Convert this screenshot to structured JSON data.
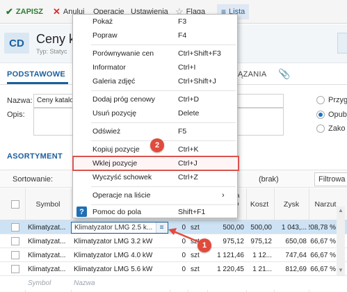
{
  "toolbar": {
    "save": "ZAPISZ",
    "cancel": "Anuluj",
    "operations": "Operacje",
    "settings": "Ustawienia",
    "flag": "Flaga",
    "list": "Lista"
  },
  "header": {
    "badge": "CD",
    "title": "Ceny k",
    "subtitle": "Typ: Statyc"
  },
  "tabs": {
    "main": "PODSTAWOWE",
    "other": "ĄZANIA"
  },
  "form": {
    "name_label": "Nazwa:",
    "name_value": "Ceny katalo",
    "desc_label": "Opis:",
    "radios": [
      {
        "label": "Przyg",
        "checked": false
      },
      {
        "label": "Opub",
        "checked": true
      },
      {
        "label": "Zako",
        "checked": false
      }
    ]
  },
  "section": {
    "title": "ASORTYMENT",
    "sort_label": "Sortowanie:",
    "sort_value": "(brak)",
    "filter_label": "Filtrowa"
  },
  "grid": {
    "columns": {
      "symbol": "Symbol",
      "cena": "Cena\nnetto\nakcji",
      "koszt": "Koszt",
      "zysk": "Zysk",
      "narzut": "Narzut"
    },
    "rows": [
      {
        "symbol": "Klimatyzat...",
        "name": "Klimatyzator LMG 2.5 k...",
        "qty": "0",
        "unit": "szt",
        "cena": "500,00",
        "koszt": "500,00",
        "zysk": "1 043,...",
        "narzut": "208,78 %",
        "selected": true
      },
      {
        "symbol": "Klimatyzat...",
        "name": "Klimatyzator LMG 3.2 kW",
        "qty": "0",
        "unit": "szt",
        "cena": "975,12",
        "koszt": "975,12",
        "zysk": "650,08",
        "narzut": "66,67 %",
        "selected": false
      },
      {
        "symbol": "Klimatyzat...",
        "name": "Klimatyzator LMG 4.0 kW",
        "qty": "0",
        "unit": "szt",
        "cena": "1 121,46",
        "koszt": "1 12...",
        "zysk": "747,64",
        "narzut": "66,67 %",
        "selected": false
      },
      {
        "symbol": "Klimatyzat...",
        "name": "Klimatyzator LMG 5.6 kW",
        "qty": "0",
        "unit": "szt",
        "cena": "1 220,45",
        "koszt": "1 21...",
        "zysk": "812,69",
        "narzut": "66,67 %",
        "selected": false
      }
    ],
    "new_row": {
      "symbol": "Symbol",
      "name": "Nazwa"
    }
  },
  "menu": {
    "items": [
      {
        "label": "Pokaż",
        "shortcut": "F3"
      },
      {
        "label": "Popraw",
        "shortcut": "F4"
      },
      {
        "label": "Porównywanie cen",
        "shortcut": "Ctrl+Shift+F3"
      },
      {
        "label": "Informator",
        "shortcut": "Ctrl+I"
      },
      {
        "label": "Galeria zdjęć",
        "shortcut": "Ctrl+Shift+J"
      },
      {
        "label": "Dodaj próg cenowy",
        "shortcut": "Ctrl+D"
      },
      {
        "label": "Usuń pozycję",
        "shortcut": "Delete"
      },
      {
        "label": "Odśwież",
        "shortcut": "F5"
      },
      {
        "label": "Kopiuj pozycje",
        "shortcut": "Ctrl+K"
      },
      {
        "label": "Wklej pozycje",
        "shortcut": "Ctrl+J"
      },
      {
        "label": "Wyczyść schowek",
        "shortcut": "Ctrl+Z"
      },
      {
        "label": "Operacje na liście",
        "shortcut": ""
      },
      {
        "label": "Pomoc do pola",
        "shortcut": "Shift+F1"
      }
    ],
    "help_icon": "?",
    "submenu_arrow": "›"
  },
  "annotations": {
    "step1": "1",
    "step2": "2",
    "color": "#e04b3c"
  },
  "colors": {
    "accent": "#1a5f9e",
    "save": "#2e7d32",
    "cancel": "#d32f2f",
    "selected_row": "#cde3f5",
    "highlight": "#d9534f"
  }
}
